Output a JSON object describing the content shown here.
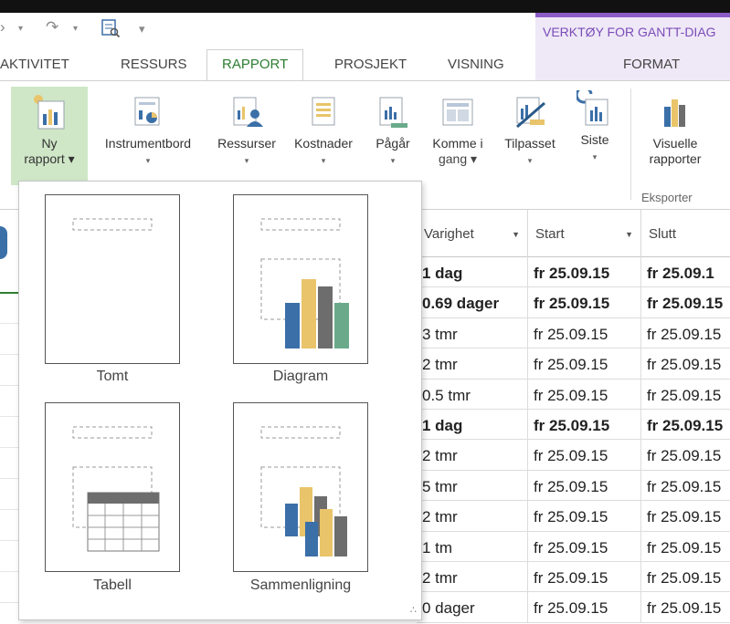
{
  "quick_access": {
    "redo_glyph": "↷",
    "save_glyph": "▾"
  },
  "context_tab_group": {
    "label": "VERKTØY FOR GANTT-DIAG"
  },
  "tabs": [
    {
      "label": "AKTIVITET",
      "active": false
    },
    {
      "label": "RESSURS",
      "active": false
    },
    {
      "label": "RAPPORT",
      "active": true
    },
    {
      "label": "PROSJEKT",
      "active": false
    },
    {
      "label": "VISNING",
      "active": false
    },
    {
      "label": "FORMAT",
      "active": false
    }
  ],
  "ribbon": {
    "buttons": [
      {
        "line1": "Ny",
        "line2": "rapport ▾",
        "icon": "new-report-icon"
      },
      {
        "line1": "Instrumentbord",
        "line2": "▾",
        "icon": "dashboard-icon"
      },
      {
        "line1": "Ressurser",
        "line2": "▾",
        "icon": "resources-icon"
      },
      {
        "line1": "Kostnader",
        "line2": "▾",
        "icon": "costs-icon"
      },
      {
        "line1": "Pågår",
        "line2": "▾",
        "icon": "in-progress-icon"
      },
      {
        "line1": "Komme i",
        "line2": "gang ▾",
        "icon": "getting-started-icon"
      },
      {
        "line1": "Tilpasset",
        "line2": "▾",
        "icon": "custom-icon"
      },
      {
        "line1": "Siste",
        "line2": "▾",
        "icon": "recent-icon"
      },
      {
        "line1": "Visuelle",
        "line2": "rapporter",
        "icon": "visual-reports-icon"
      }
    ],
    "group_label": "Eksporter"
  },
  "new_report_menu": {
    "options": [
      {
        "label": "Tomt",
        "icon": "blank-report-icon"
      },
      {
        "label": "Diagram",
        "icon": "chart-report-icon"
      },
      {
        "label": "Tabell",
        "icon": "table-report-icon"
      },
      {
        "label": "Sammenligning",
        "icon": "comparison-report-icon"
      }
    ]
  },
  "table": {
    "columns": [
      "Varighet",
      "Start",
      "Slutt"
    ],
    "rows": [
      {
        "duration": "1 dag",
        "start": "fr 25.09.15",
        "end": "fr 25.09.1",
        "bold": true
      },
      {
        "duration": "0.69 dager",
        "start": "fr 25.09.15",
        "end": "fr 25.09.15",
        "bold": true
      },
      {
        "duration": "3 tmr",
        "start": "fr 25.09.15",
        "end": "fr 25.09.15",
        "bold": false
      },
      {
        "duration": "2 tmr",
        "start": "fr 25.09.15",
        "end": "fr 25.09.15",
        "bold": false
      },
      {
        "duration": "0.5 tmr",
        "start": "fr 25.09.15",
        "end": "fr 25.09.15",
        "bold": false
      },
      {
        "duration": "1 dag",
        "start": "fr 25.09.15",
        "end": "fr 25.09.15",
        "bold": true
      },
      {
        "duration": "2 tmr",
        "start": "fr 25.09.15",
        "end": "fr 25.09.15",
        "bold": false
      },
      {
        "duration": "5 tmr",
        "start": "fr 25.09.15",
        "end": "fr 25.09.15",
        "bold": false
      },
      {
        "duration": "2 tmr",
        "start": "fr 25.09.15",
        "end": "fr 25.09.15",
        "bold": false
      },
      {
        "duration": "1 tm",
        "start": "fr 25.09.15",
        "end": "fr 25.09.15",
        "bold": false
      },
      {
        "duration": "2 tmr",
        "start": "fr 25.09.15",
        "end": "fr 25.09.15",
        "bold": false
      },
      {
        "duration": "0 dager",
        "start": "fr 25.09.15",
        "end": "fr 25.09.15",
        "bold": false
      }
    ]
  },
  "colors": {
    "accent_green": "#2e7d32",
    "context_purple": "#8b5cc8",
    "selected_button": "#cfe7c7",
    "bar_blue": "#3b6fa8",
    "bar_gold": "#e9c46a",
    "bar_gray": "#6d6d6d",
    "bar_teal": "#6aaa8a"
  }
}
